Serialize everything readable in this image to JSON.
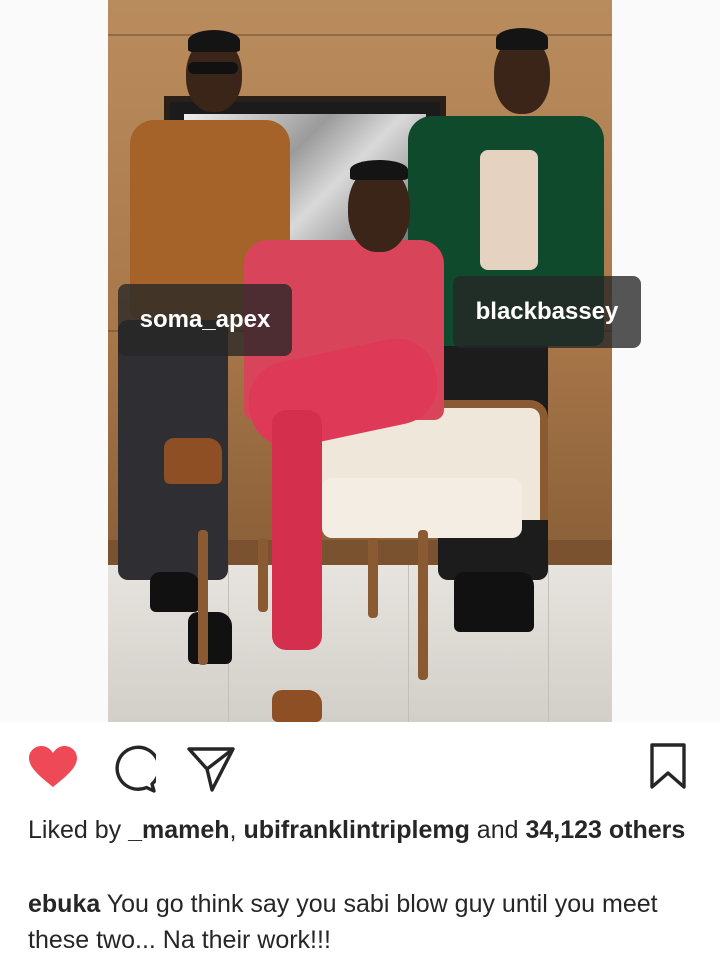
{
  "post": {
    "tags": {
      "left": "soma_apex",
      "right": "blackbassey"
    }
  },
  "actions": {
    "like_icon": "heart-filled-icon",
    "comment_icon": "comment-bubble-icon",
    "share_icon": "paper-plane-icon",
    "save_icon": "bookmark-icon",
    "like_color": "#ed4956"
  },
  "likes": {
    "prefix": "Liked by",
    "user1": "_mameh",
    "separator": ",",
    "user2": "ubifranklintriplemg",
    "conjunction": "and",
    "count": "34,123",
    "others": "others"
  },
  "caption": {
    "username": "ebuka",
    "text": "You go think say you sabi blow guy until you meet these two... Na their work!!!"
  }
}
